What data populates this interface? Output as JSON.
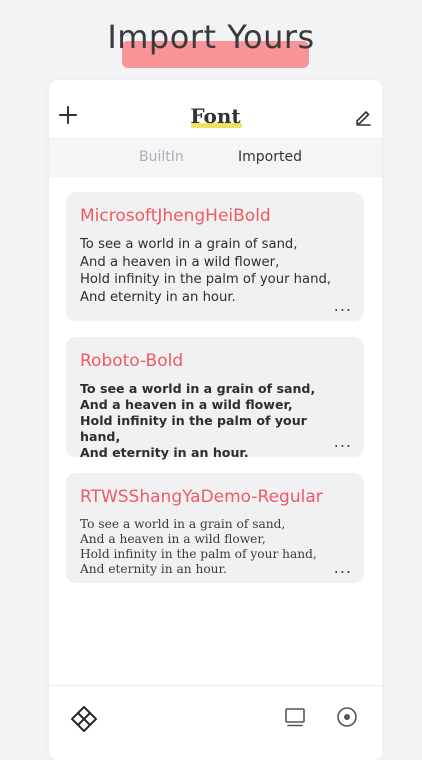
{
  "promo": {
    "title": "Import Yours"
  },
  "nav": {
    "title": "Font"
  },
  "tabs": [
    {
      "label": "BuiltIn",
      "active": false
    },
    {
      "label": "Imported",
      "active": true
    }
  ],
  "fonts": [
    {
      "name": "MicrosoftJhengHeiBold",
      "sample": "To see a world in a grain of sand,\nAnd a heaven in a wild flower,\nHold infinity in the palm of your hand,\nAnd eternity in an hour.",
      "more": "..."
    },
    {
      "name": "Roboto-Bold",
      "sample": "To see a world in a grain of sand,\nAnd a heaven in a wild flower,\nHold infinity in the palm of your hand,\nAnd eternity in an hour.",
      "more": "..."
    },
    {
      "name": "RTWSShangYaDemo-Regular",
      "sample": "To see a world in a grain of sand,\nAnd a heaven in a wild flower,\nHold infinity in the palm of your hand,\nAnd eternity in an hour.",
      "more": "..."
    }
  ],
  "icons": {
    "add": "plus-icon",
    "edit": "pencil-icon",
    "bottom_left": "diamond-grid-icon",
    "bottom_mid": "monitor-icon",
    "bottom_right": "target-icon"
  },
  "colors": {
    "accent_red": "#ee5a61",
    "promo_highlight": "#f97b7e",
    "title_underline": "#f2e25b"
  }
}
